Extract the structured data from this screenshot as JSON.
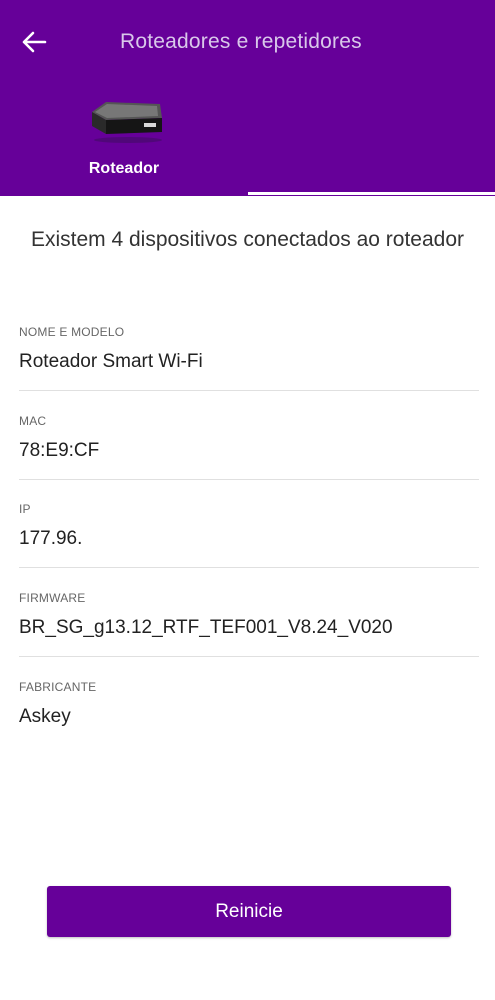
{
  "header": {
    "title": "Roteadores e repetidores",
    "back_icon": "arrow-left-icon",
    "bg_color": "#660099"
  },
  "tabs": [
    {
      "label": "Roteador",
      "icon": "router-device-image",
      "selected": true
    }
  ],
  "summary": "Existem 4 dispositivos conectados ao roteador",
  "fields": [
    {
      "label": "NOME E MODELO",
      "value": "Roteador Smart Wi-Fi"
    },
    {
      "label": "MAC",
      "value": "78:E9:CF"
    },
    {
      "label": "IP",
      "value": "177.96."
    },
    {
      "label": "FIRMWARE",
      "value": "BR_SG_g13.12_RTF_TEF001_V8.24_V020"
    },
    {
      "label": "FABRICANTE",
      "value": "Askey"
    }
  ],
  "actions": {
    "restart_label": "Reinicie"
  }
}
